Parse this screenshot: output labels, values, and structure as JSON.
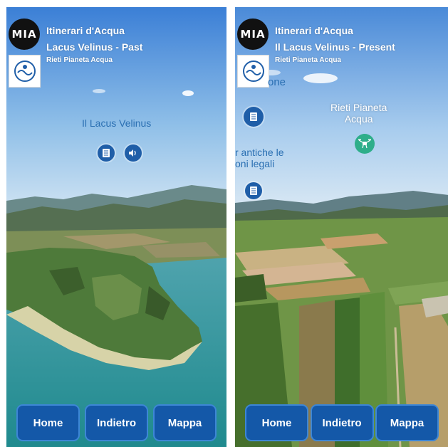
{
  "left_screen": {
    "app_title": "Itinerari d'Acqua",
    "subtitle": "Lacus Velinus - Past",
    "org": "Rieti Pianeta Acqua",
    "logo_text": "MIA",
    "hotspot_label": "Il Lacus Velinus",
    "icons": [
      "document-icon",
      "speaker-icon"
    ],
    "nav": {
      "home": "Home",
      "back": "Indietro",
      "map": "Mappa"
    }
  },
  "right_screen": {
    "app_title": "Itinerari d'Acqua",
    "subtitle": "Il Lacus Velinus - Present",
    "org": "Rieti Pianeta Acqua",
    "logo_text": "MIA",
    "partial_label_top": "one",
    "hotspot_label_line1": "Rieti Pianeta",
    "hotspot_label_line2": "Acqua",
    "partial_label_mid_line1": "r antiche le",
    "partial_label_mid_line2": "oni legali",
    "icons": [
      "document-icon",
      "drone-icon",
      "document-icon"
    ],
    "nav": {
      "home": "Home",
      "back": "Indietro",
      "map": "Mappa"
    }
  },
  "colors": {
    "sky_top": "#3d82d8",
    "sky_bottom": "#cfe3f4",
    "button_blue": "#1458a8",
    "drone_green": "#2eae8a",
    "lake": "#2f8f9a"
  }
}
